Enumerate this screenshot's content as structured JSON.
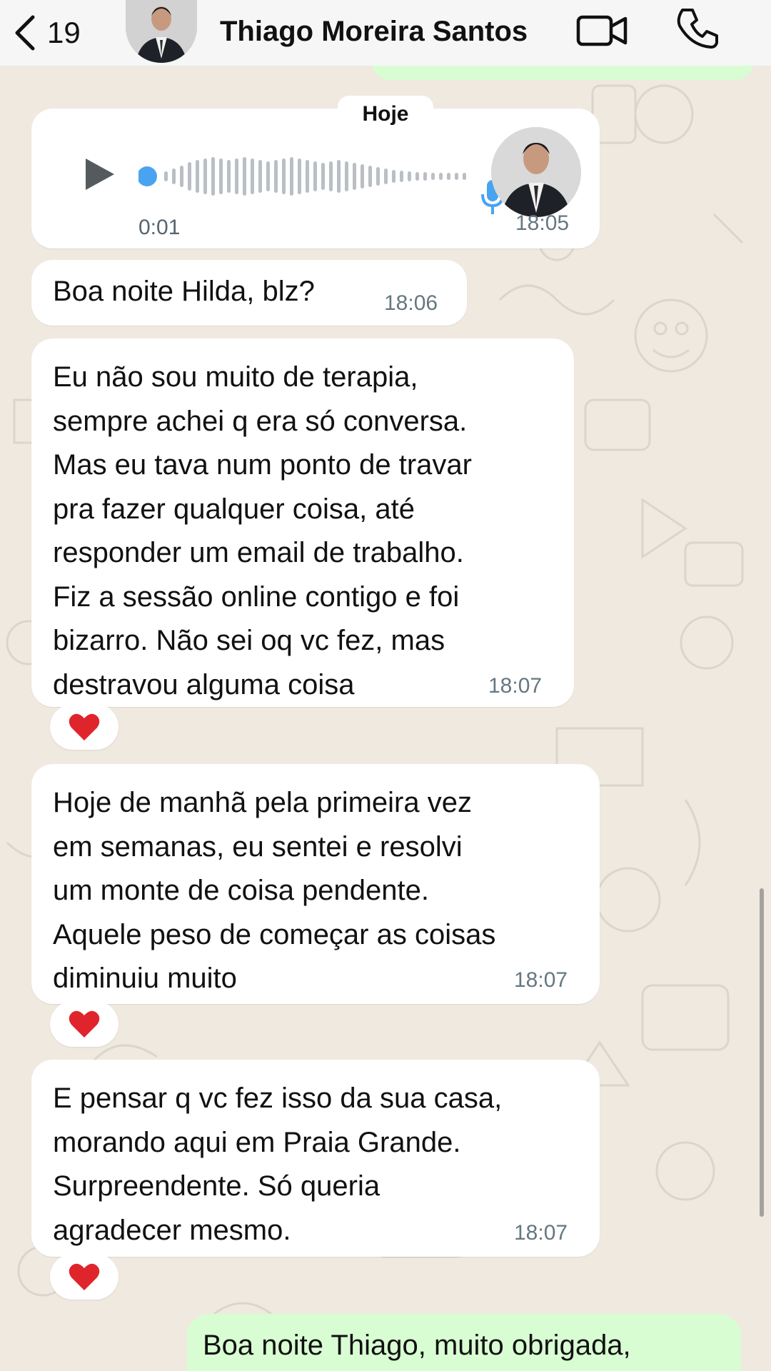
{
  "header": {
    "back_count": "19",
    "contact_name": "Thiago Moreira Santos"
  },
  "date_chip": "Hoje",
  "voice_message": {
    "duration": "0:01",
    "time": "18:05"
  },
  "messages": [
    {
      "text": "Boa noite Hilda, blz?",
      "time": "18:06"
    },
    {
      "text": "Eu não sou muito de terapia,\nsempre achei q era só conversa.\nMas eu tava num ponto de travar\npra fazer qualquer coisa, até\nresponder um email de trabalho.\nFiz a sessão online contigo e foi\nbizarro. Não sei oq vc fez, mas\ndestravou alguma coisa",
      "time": "18:07",
      "reaction": "heart"
    },
    {
      "text": "Hoje de manhã pela primeira vez\nem semanas, eu sentei e resolvi\num monte de coisa pendente.\nAquele peso de começar as coisas\ndiminuiu muito",
      "time": "18:07",
      "reaction": "heart"
    },
    {
      "text": "E pensar q vc fez isso da sua casa,\nmorando aqui em Praia Grande.\nSurpreendente. Só queria\nagradecer mesmo.",
      "time": "18:07",
      "reaction": "heart"
    }
  ],
  "outgoing_message": {
    "text": "Boa noite Thiago, muito obrigada,"
  },
  "colors": {
    "incoming_bubble": "#ffffff",
    "outgoing_bubble": "#d9fdd3",
    "wallpaper": "#efe9e0",
    "play_accent": "#4aa3f0",
    "heart": "#e0242b"
  }
}
